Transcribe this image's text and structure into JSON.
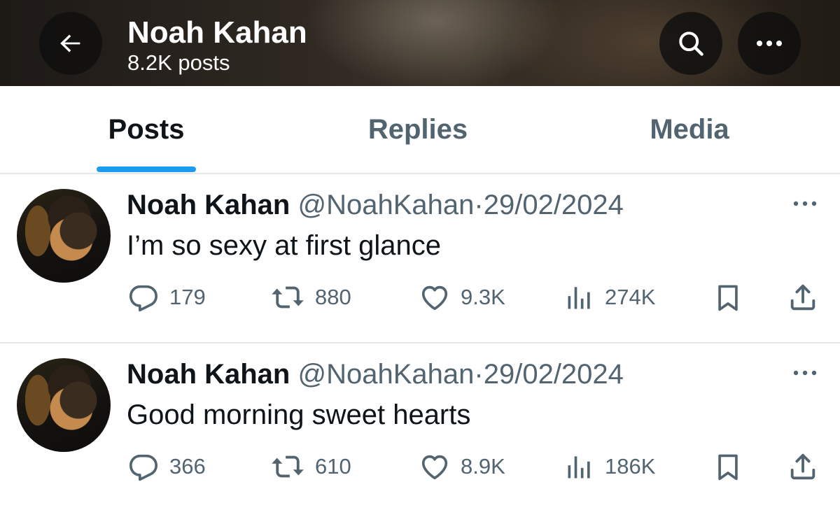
{
  "header": {
    "title": "Noah Kahan",
    "subtitle": "8.2K posts",
    "back_icon": "arrow-left-icon",
    "search_icon": "search-icon",
    "more_icon": "more-horizontal-icon"
  },
  "tabs": [
    {
      "label": "Posts",
      "active": true
    },
    {
      "label": "Replies",
      "active": false
    },
    {
      "label": "Media",
      "active": false
    }
  ],
  "colors": {
    "accent": "#1d9bf0",
    "primary_text": "#0f1419",
    "secondary_text": "#536471"
  },
  "posts": [
    {
      "author": "Noah Kahan",
      "handle": "@NoahKahan",
      "separator": "·",
      "date": "29/02/2024",
      "text": "I’m so sexy at first glance",
      "replies": "179",
      "retweets": "880",
      "likes": "9.3K",
      "views": "274K"
    },
    {
      "author": "Noah Kahan",
      "handle": "@NoahKahan",
      "separator": "·",
      "date": "29/02/2024",
      "text": "Good morning sweet hearts",
      "replies": "366",
      "retweets": "610",
      "likes": "8.9K",
      "views": "186K"
    }
  ]
}
